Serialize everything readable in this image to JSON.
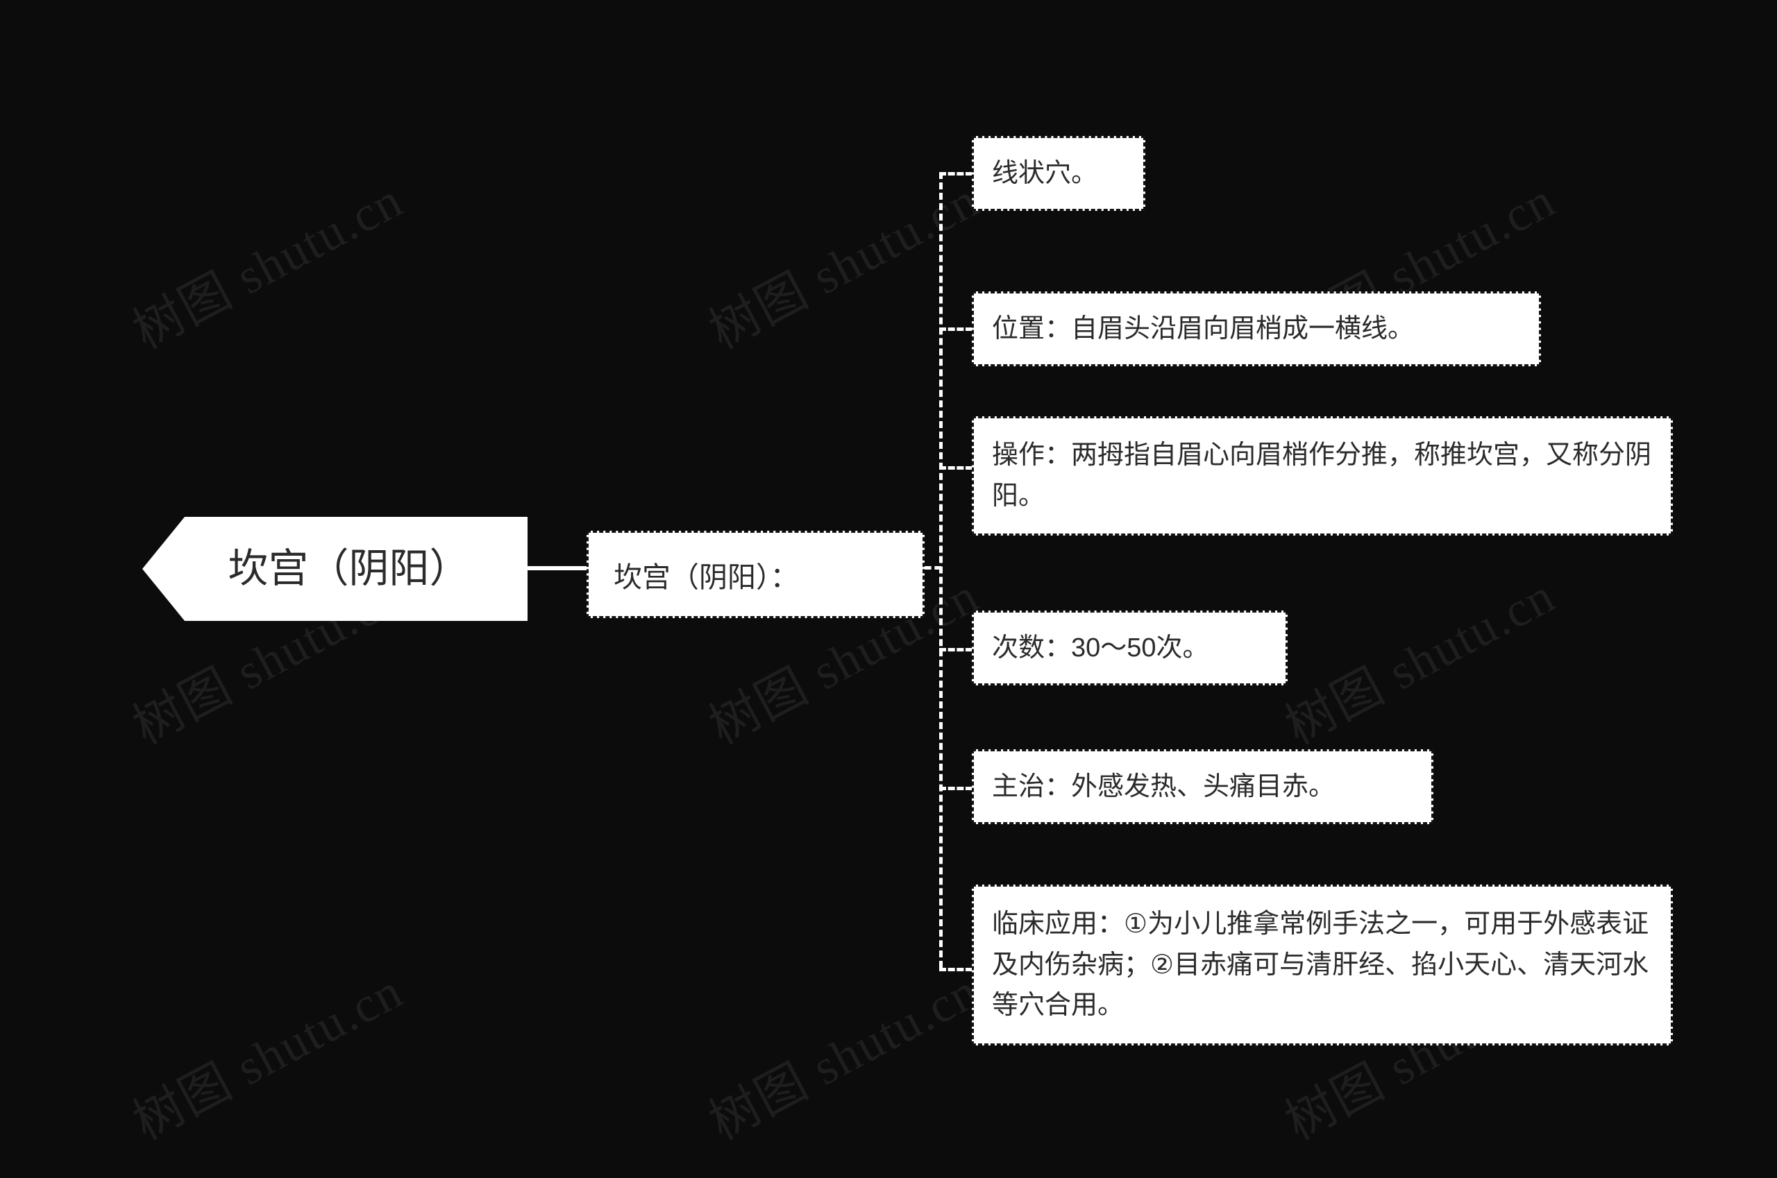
{
  "canvas": {
    "background_color": "#0c0c0c",
    "node_fill_color": "#ffffff",
    "node_text_color": "#2b2b2b",
    "connector_color": "#ffffff",
    "node_border_color": "#111111"
  },
  "watermark": {
    "text": "树图 shutu.cn",
    "color": "#1e1e1e"
  },
  "mindmap": {
    "root": {
      "label": "坎宫（阴阳）"
    },
    "branch": {
      "label": "坎宫（阴阳）："
    },
    "leaves": [
      {
        "label": "线状穴。"
      },
      {
        "label": "位置：自眉头沿眉向眉梢成一横线。"
      },
      {
        "label": "操作：两拇指自眉心向眉梢作分推，称推坎宫，又称分阴阳。"
      },
      {
        "label": "次数：30～50次。"
      },
      {
        "label": "主治：外感发热、头痛目赤。"
      },
      {
        "label": "临床应用：①为小儿推拿常例手法之一，可用于外感表证及内伤杂病；②目赤痛可与清肝经、掐小天心、清天河水等穴合用。"
      }
    ]
  }
}
